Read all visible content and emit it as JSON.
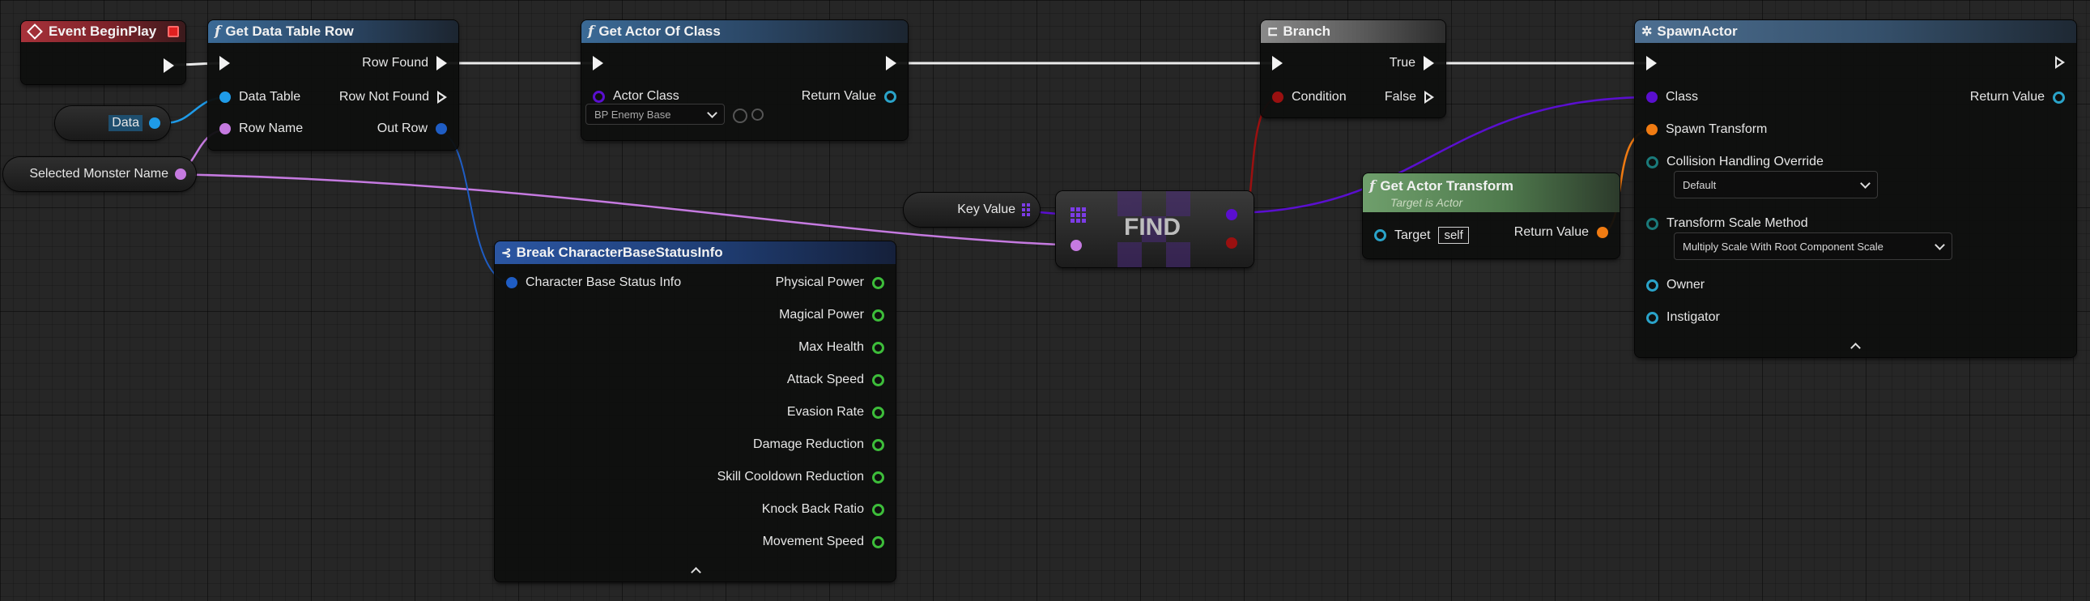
{
  "nodes": {
    "event_begin_play": {
      "title": "Event BeginPlay"
    },
    "get_data_table_row": {
      "title": "Get Data Table Row",
      "pins": {
        "data_table": "Data Table",
        "row_name": "Row Name",
        "row_found": "Row Found",
        "row_not_found": "Row Not Found",
        "out_row": "Out Row"
      }
    },
    "get_actor_of_class": {
      "title": "Get Actor Of Class",
      "pins": {
        "actor_class": "Actor Class",
        "return_value": "Return Value"
      },
      "actor_class_value": "BP Enemy Base"
    },
    "branch": {
      "title": "Branch",
      "pins": {
        "condition": "Condition",
        "true": "True",
        "false": "False"
      }
    },
    "spawn_actor": {
      "title": "SpawnActor",
      "pins": {
        "class": "Class",
        "spawn_transform": "Spawn Transform",
        "collision_override": "Collision Handling Override",
        "transform_scale": "Transform Scale Method",
        "owner": "Owner",
        "instigator": "Instigator",
        "return_value": "Return Value"
      },
      "collision_value": "Default",
      "scale_value": "Multiply Scale With Root Component Scale"
    },
    "get_actor_transform": {
      "title": "Get Actor Transform",
      "subtitle": "Target is Actor",
      "pins": {
        "target": "Target",
        "return_value": "Return Value"
      },
      "target_value": "self"
    },
    "find": {
      "title": "FIND"
    },
    "break_struct": {
      "title": "Break CharacterBaseStatusInfo",
      "input": "Character Base Status Info",
      "outputs": [
        "Physical Power",
        "Magical Power",
        "Max Health",
        "Attack Speed",
        "Evasion Rate",
        "Damage Reduction",
        "Skill Cooldown Reduction",
        "Knock Back Ratio",
        "Movement Speed"
      ]
    }
  },
  "variables": {
    "data": "Data",
    "selected_monster_name": "Selected Monster Name",
    "key_value": "Key Value"
  },
  "colors": {
    "exec": "#f2f2f2",
    "object_ref": "#1f9be8",
    "name": "#c57ae0",
    "struct": "#1f5dc4",
    "float": "#3dbd3a",
    "class": "#5a0fcf",
    "bool": "#9a1010",
    "transform": "#f07b12",
    "object": "#2aa3c9"
  }
}
